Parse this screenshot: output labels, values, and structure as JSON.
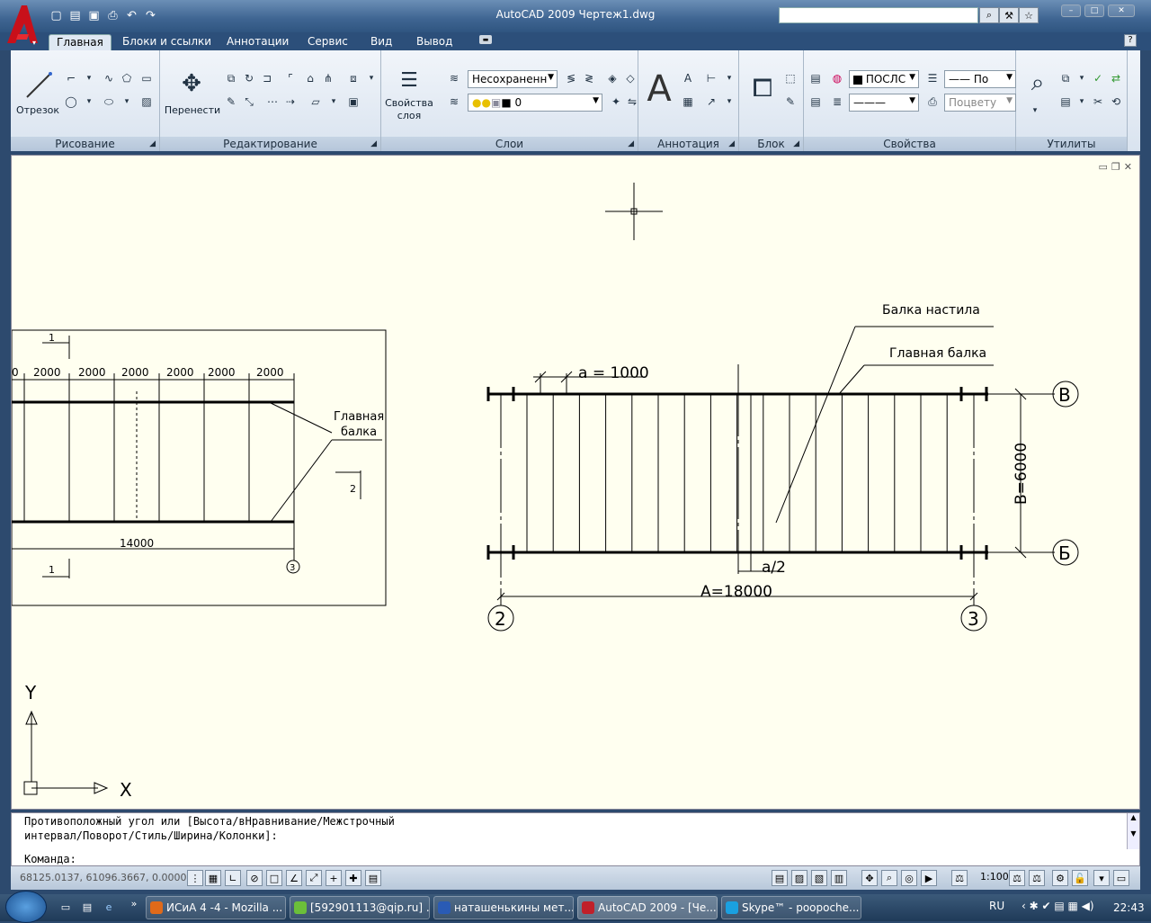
{
  "window": {
    "title": "AutoCAD 2009 Чертеж1.dwg",
    "search_placeholder": "",
    "controls": [
      "–",
      "□",
      "✕"
    ]
  },
  "ribbon_tabs": [
    "Главная",
    "Блоки и ссылки",
    "Аннотации",
    "Сервис",
    "Вид",
    "Вывод"
  ],
  "active_tab": "Главная",
  "panels": {
    "draw": {
      "label": "Рисование",
      "big_button": "Отрезок"
    },
    "modify": {
      "label": "Редактирование",
      "big_button": "Перенести"
    },
    "layers": {
      "label": "Слои",
      "big_button_line1": "Свойства",
      "big_button_line2": "слоя",
      "layer_state": "Несохраненн",
      "current_layer": "0"
    },
    "annotation": {
      "label": "Аннотация",
      "big_glyph": "A"
    },
    "block": {
      "label": "Блок"
    },
    "properties": {
      "label": "Свойства",
      "color": "ПОСЛС",
      "linetype": "По",
      "plotstyle": "Поцвету"
    },
    "utilities": {
      "label": "Утилиты"
    }
  },
  "drawing": {
    "left_view": {
      "section_mark_top": "1",
      "section_mark_bottom": "1",
      "dims": [
        "0",
        "2000",
        "2000",
        "2000",
        "2000",
        "2000",
        "2000"
      ],
      "total_dim": "14000",
      "label_line1": "Главная",
      "label_line2": "балка",
      "mark2": "2",
      "axis": "3"
    },
    "right_view": {
      "label_deck_beam": "Балка настила",
      "label_main_beam": "Главная балка",
      "dim_a": "a = 1000",
      "dim_a2": "a/2",
      "dim_A": "A=18000",
      "dim_B": "B=6000",
      "axis_B": "В",
      "axis_Bb": "Б",
      "axis_2": "2",
      "axis_3": "3"
    },
    "ucs": {
      "x": "X",
      "y": "Y"
    }
  },
  "command": {
    "line1": "Противоположный угол или [Высота/вНравнивание/Межстрочный",
    "line2": "интервал/Поворот/Стиль/Ширина/Колонки]:",
    "prompt": "Команда:"
  },
  "status": {
    "coords": "68125.0137, 61096.3667, 0.0000",
    "scale": "1:100"
  },
  "taskbar": {
    "items": [
      {
        "label": "ИСиА 4 -4 - Mozilla ...",
        "color": "#e06a1a"
      },
      {
        "label": "[592901113@qip.ru] ...",
        "color": "#6bbf3a"
      },
      {
        "label": "наташенькины мет...",
        "color": "#2a5bb5"
      },
      {
        "label": "AutoCAD 2009 - [Че...",
        "color": "#c0202a"
      },
      {
        "label": "Skype™ - poopoche...",
        "color": "#1aa0e0"
      }
    ],
    "lang": "RU",
    "time": "22:43"
  }
}
